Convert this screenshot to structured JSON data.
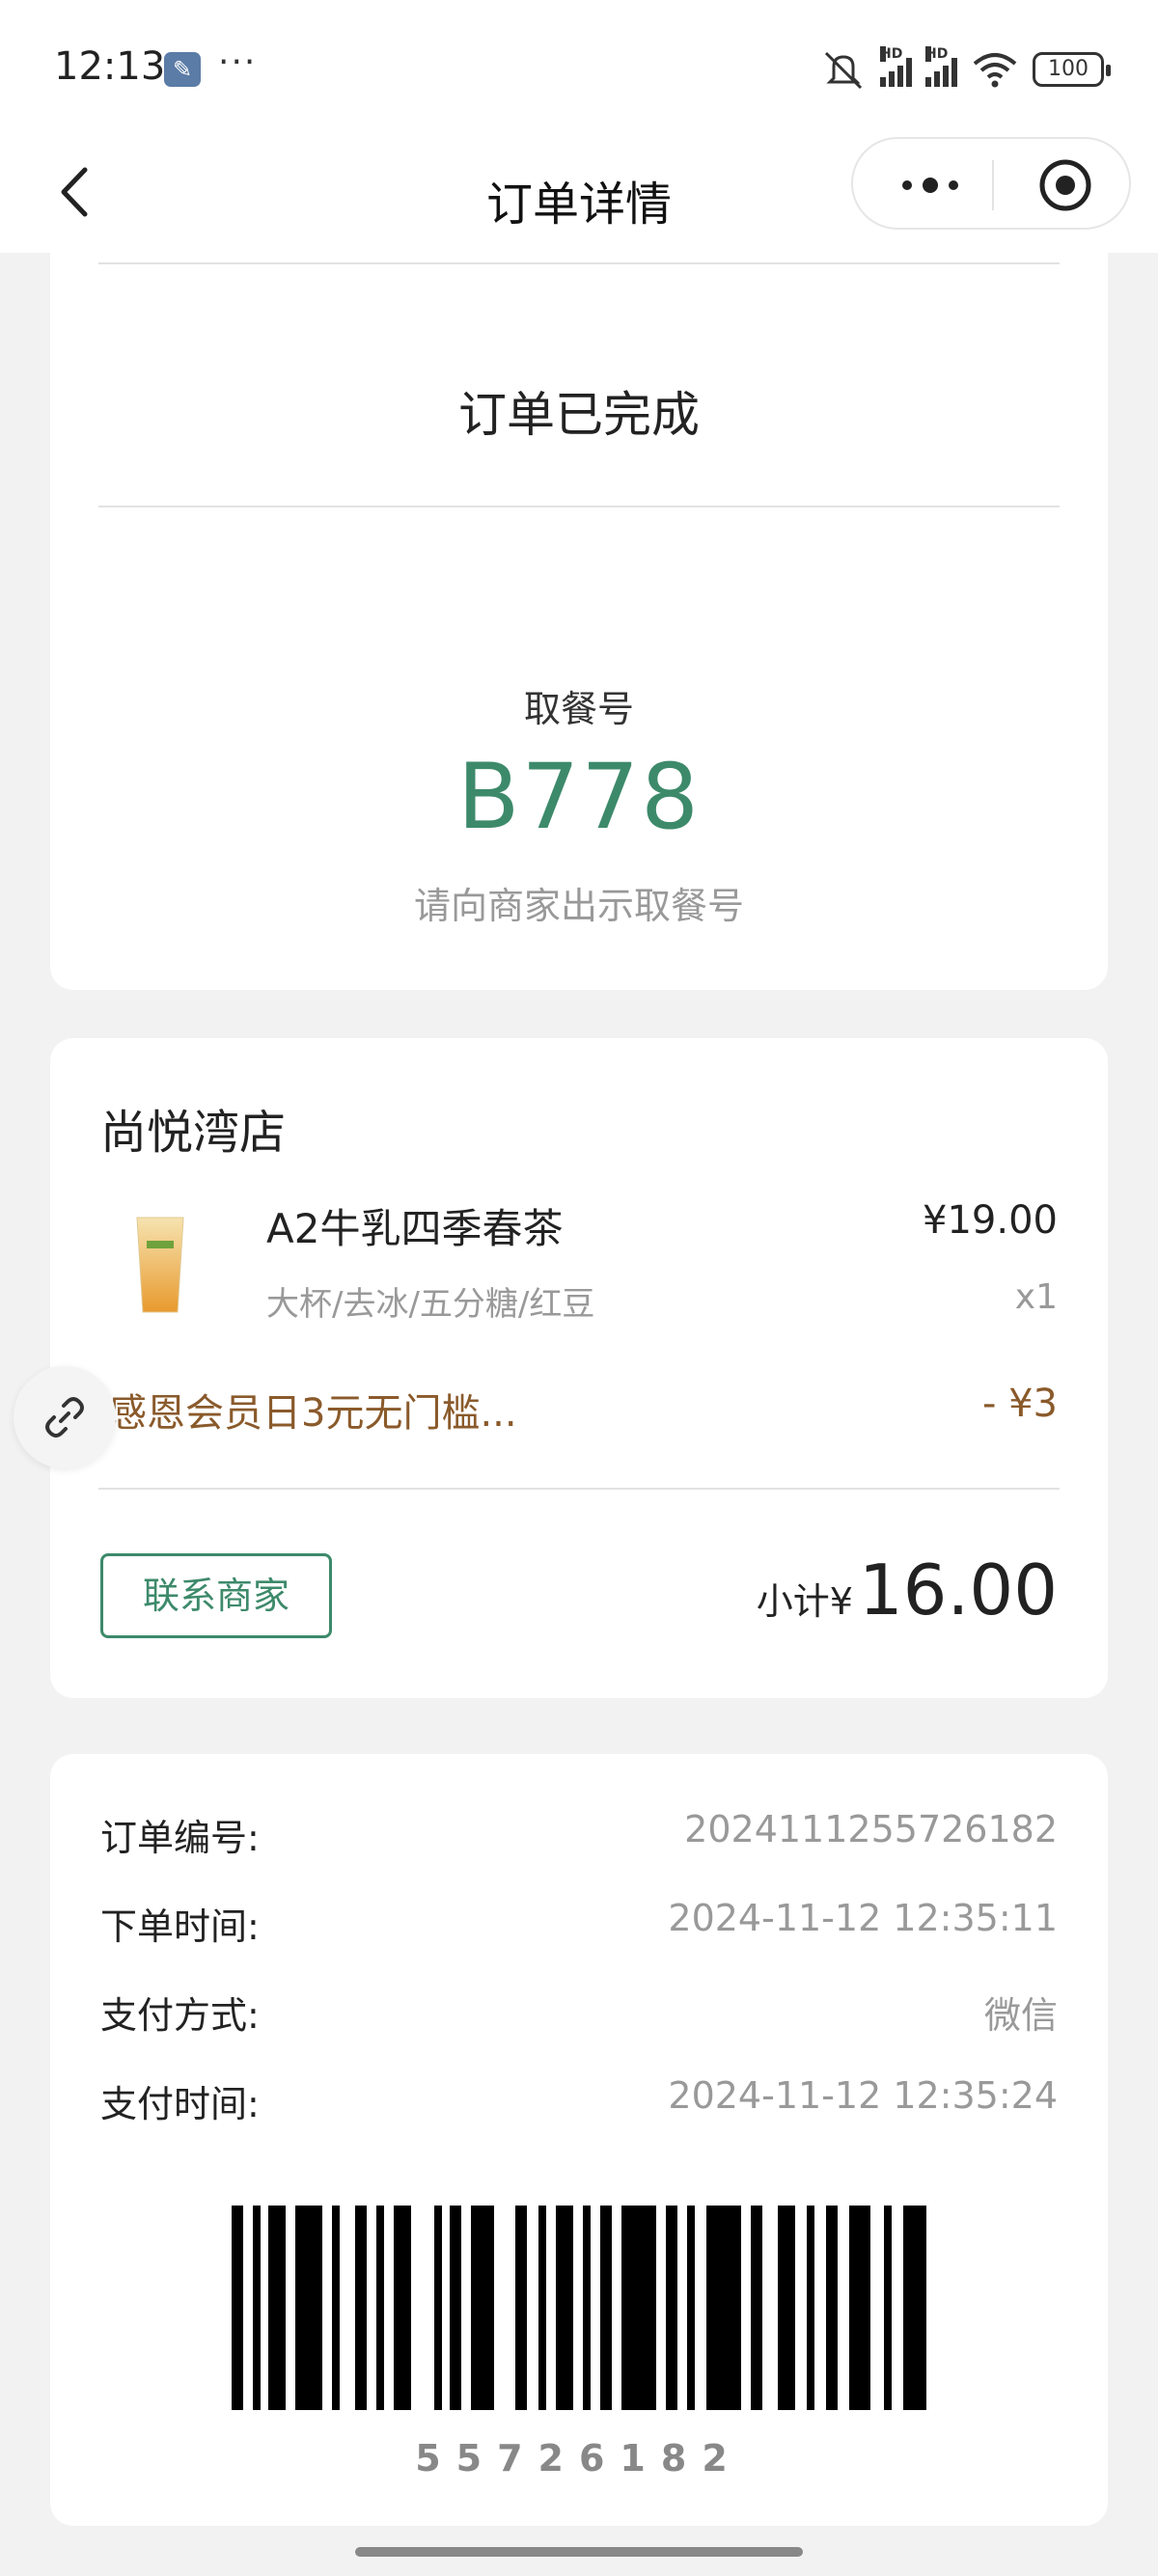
{
  "status_bar": {
    "time": "12:13",
    "dots": "···",
    "battery": "100",
    "hd1": "HD",
    "hd2": "HD"
  },
  "nav": {
    "title": "订单详情"
  },
  "order_status": {
    "status_text": "订单已完成",
    "pickup_label": "取餐号",
    "pickup_number": "B778",
    "pickup_hint": "请向商家出示取餐号"
  },
  "order_items": {
    "store_name": "尚悦湾店",
    "items": [
      {
        "name": "A2牛乳四季春茶",
        "price": "¥19.00",
        "spec": "大杯/去冰/五分糖/红豆",
        "qty": "x1"
      }
    ],
    "discount": {
      "name": "感恩会员日3元无门槛...",
      "amount": "- ¥3"
    },
    "contact_label": "联系商家",
    "subtotal_label": "小计¥",
    "subtotal_value": "16.00"
  },
  "order_info": {
    "rows": [
      {
        "key": "订单编号:",
        "value": "2024111255726182"
      },
      {
        "key": "下单时间:",
        "value": "2024-11-12 12:35:11"
      },
      {
        "key": "支付方式:",
        "value": "微信"
      },
      {
        "key": "支付时间:",
        "value": "2024-11-12 12:35:24"
      }
    ],
    "barcode_number": "55726182"
  },
  "colors": {
    "accent": "#3d8a6b",
    "discount": "#8a5a2b",
    "muted": "#999999"
  },
  "icons": [
    "wrench-icon",
    "mute-icon",
    "signal-icon",
    "wifi-icon",
    "battery-icon",
    "back-icon",
    "more-icon",
    "target-icon",
    "link-icon"
  ]
}
